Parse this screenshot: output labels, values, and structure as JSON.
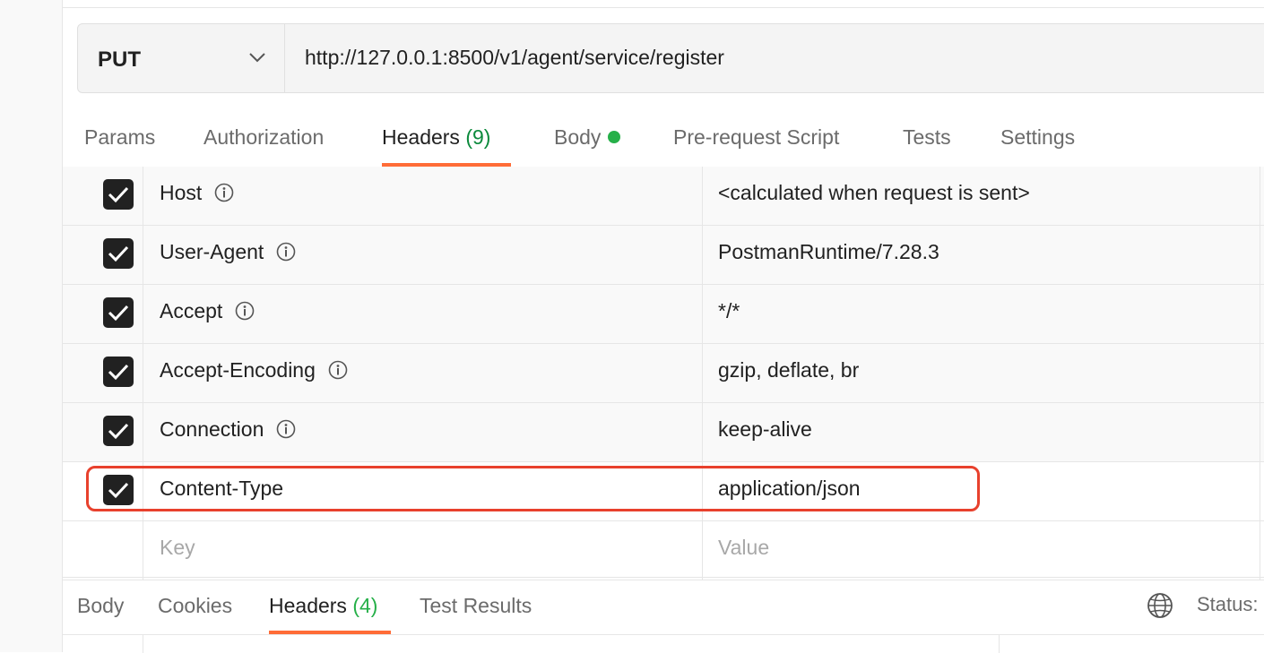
{
  "request": {
    "method": "PUT",
    "url": "http://127.0.0.1:8500/v1/agent/service/register"
  },
  "request_tabs": [
    {
      "label": "Params"
    },
    {
      "label": "Authorization"
    },
    {
      "label": "Headers",
      "count": "(9)"
    },
    {
      "label": "Body"
    },
    {
      "label": "Pre-request Script"
    },
    {
      "label": "Tests"
    },
    {
      "label": "Settings"
    }
  ],
  "headers": [
    {
      "key": "Host",
      "value": "<calculated when request is sent>",
      "checked": true,
      "icon": "info-icon"
    },
    {
      "key": "User-Agent",
      "value": "PostmanRuntime/7.28.3",
      "checked": true,
      "icon": "info-icon"
    },
    {
      "key": "Accept",
      "value": "*/*",
      "checked": true,
      "icon": "info-icon"
    },
    {
      "key": "Accept-Encoding",
      "value": "gzip, deflate, br",
      "checked": true,
      "icon": "info-icon"
    },
    {
      "key": "Connection",
      "value": "keep-alive",
      "checked": true,
      "icon": "info-icon"
    },
    {
      "key": "Content-Type",
      "value": "application/json",
      "checked": true
    }
  ],
  "new_row": {
    "key_placeholder": "Key",
    "value_placeholder": "Value"
  },
  "response_tabs": [
    {
      "label": "Body"
    },
    {
      "label": "Cookies"
    },
    {
      "label": "Headers",
      "count": "(4)"
    },
    {
      "label": "Test Results"
    }
  ],
  "response_status_label": "Status:",
  "colors": {
    "accent": "#ff6c37",
    "count_green": "#0c8a3c",
    "body_dot": "#26b049",
    "highlight": "#e8412d"
  }
}
